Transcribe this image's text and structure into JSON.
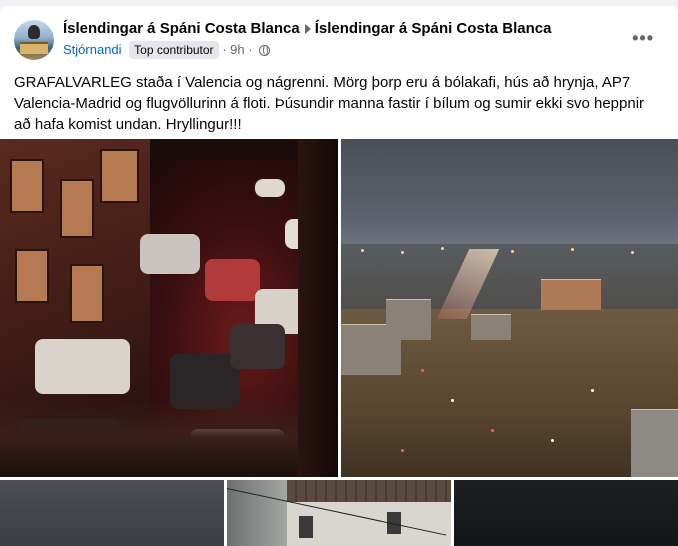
{
  "post": {
    "author": "Íslendingar á Spáni Costa Blanca",
    "group": "Íslendingar á Spáni Costa Blanca",
    "role": "Stjórnandi",
    "badge": "Top contributor",
    "separator": "·",
    "time": "9h",
    "time_separator": "·",
    "privacy_icon": "globe-icon",
    "more_icon": "more-options-icon",
    "text": "GRAFALVARLEG staða í Valencia og nágrenni. Mörg þorp eru á bólakafi, hús að hrynja, AP7 Valencia-Madrid og flugvöllurinn á floti. Þúsundir manna fastir í bílum og sumir ekki svo heppnir að hafa komist undan. Hryllingur!!!"
  },
  "photos": [
    {
      "subject": "flooded street with cars at night"
    },
    {
      "subject": "aerial view of flooded city"
    },
    {
      "subject": "grey sky"
    },
    {
      "subject": "houses with tiled roof"
    },
    {
      "subject": "dark night sky"
    }
  ]
}
